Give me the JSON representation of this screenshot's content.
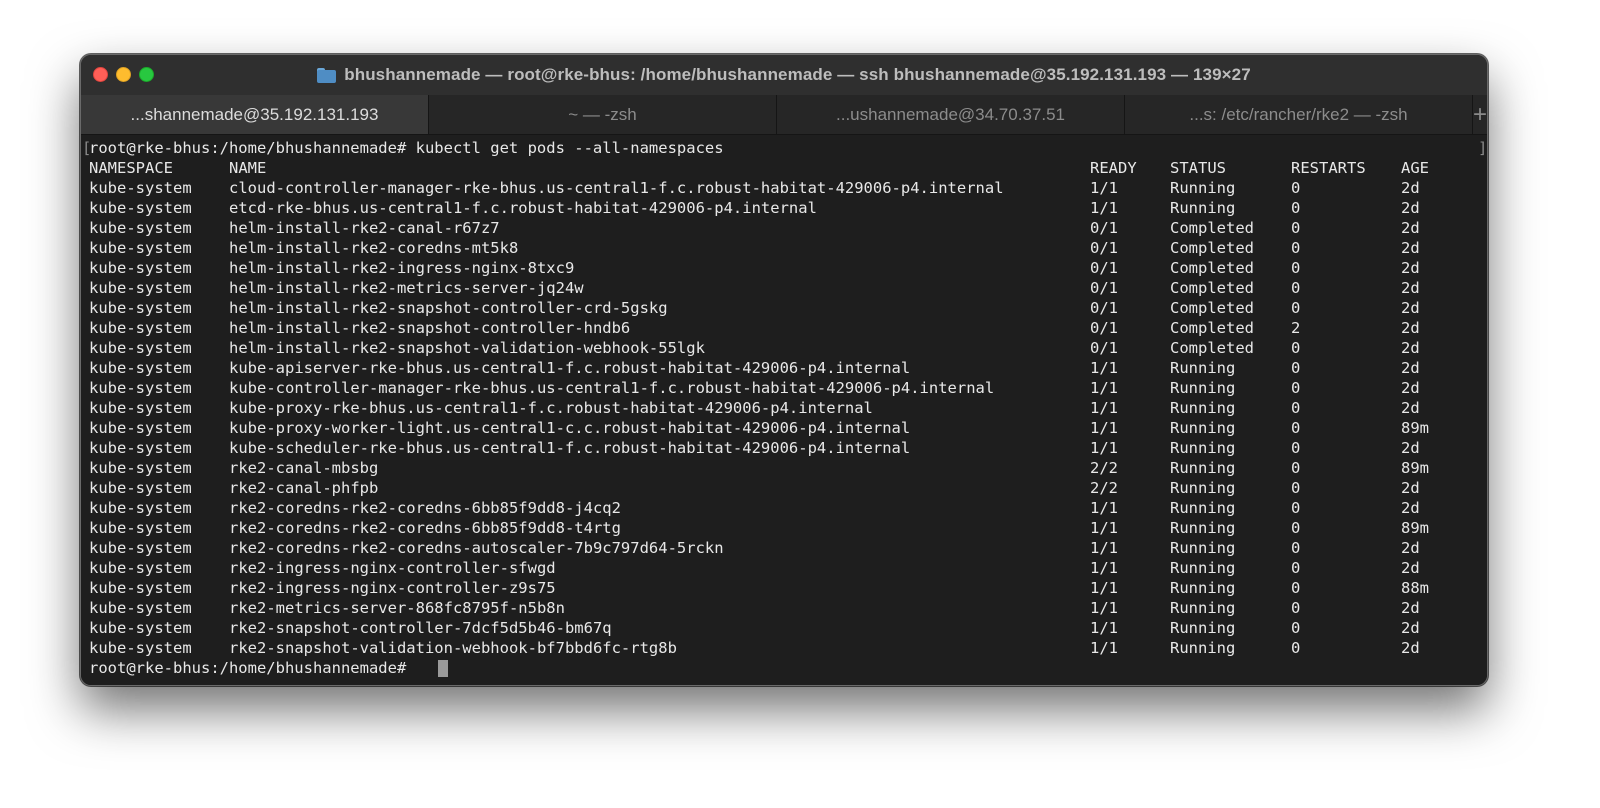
{
  "window": {
    "title": "bhushannemade — root@rke-bhus: /home/bhushannemade — ssh bhushannemade@35.192.131.193 — 139×27",
    "title_icon": "folder-icon"
  },
  "tabs": [
    {
      "label": "...shannemade@35.192.131.193",
      "active": true
    },
    {
      "label": "~ — -zsh",
      "active": false
    },
    {
      "label": "...ushannemade@34.70.37.51",
      "active": false
    },
    {
      "label": "...s: /etc/rancher/rke2 — -zsh",
      "active": false
    }
  ],
  "new_tab_label": "+",
  "terminal": {
    "command_line": "root@rke-bhus:/home/bhushannemade# kubectl get pods --all-namespaces",
    "headers": {
      "namespace": "NAMESPACE",
      "name": "NAME",
      "ready": "READY",
      "status": "STATUS",
      "restarts": "RESTARTS",
      "age": "AGE"
    },
    "rows": [
      {
        "namespace": "kube-system",
        "name": "cloud-controller-manager-rke-bhus.us-central1-f.c.robust-habitat-429006-p4.internal",
        "ready": "1/1",
        "status": "Running",
        "restarts": "0",
        "age": "2d"
      },
      {
        "namespace": "kube-system",
        "name": "etcd-rke-bhus.us-central1-f.c.robust-habitat-429006-p4.internal",
        "ready": "1/1",
        "status": "Running",
        "restarts": "0",
        "age": "2d"
      },
      {
        "namespace": "kube-system",
        "name": "helm-install-rke2-canal-r67z7",
        "ready": "0/1",
        "status": "Completed",
        "restarts": "0",
        "age": "2d"
      },
      {
        "namespace": "kube-system",
        "name": "helm-install-rke2-coredns-mt5k8",
        "ready": "0/1",
        "status": "Completed",
        "restarts": "0",
        "age": "2d"
      },
      {
        "namespace": "kube-system",
        "name": "helm-install-rke2-ingress-nginx-8txc9",
        "ready": "0/1",
        "status": "Completed",
        "restarts": "0",
        "age": "2d"
      },
      {
        "namespace": "kube-system",
        "name": "helm-install-rke2-metrics-server-jq24w",
        "ready": "0/1",
        "status": "Completed",
        "restarts": "0",
        "age": "2d"
      },
      {
        "namespace": "kube-system",
        "name": "helm-install-rke2-snapshot-controller-crd-5gskg",
        "ready": "0/1",
        "status": "Completed",
        "restarts": "0",
        "age": "2d"
      },
      {
        "namespace": "kube-system",
        "name": "helm-install-rke2-snapshot-controller-hndb6",
        "ready": "0/1",
        "status": "Completed",
        "restarts": "2",
        "age": "2d"
      },
      {
        "namespace": "kube-system",
        "name": "helm-install-rke2-snapshot-validation-webhook-55lgk",
        "ready": "0/1",
        "status": "Completed",
        "restarts": "0",
        "age": "2d"
      },
      {
        "namespace": "kube-system",
        "name": "kube-apiserver-rke-bhus.us-central1-f.c.robust-habitat-429006-p4.internal",
        "ready": "1/1",
        "status": "Running",
        "restarts": "0",
        "age": "2d"
      },
      {
        "namespace": "kube-system",
        "name": "kube-controller-manager-rke-bhus.us-central1-f.c.robust-habitat-429006-p4.internal",
        "ready": "1/1",
        "status": "Running",
        "restarts": "0",
        "age": "2d"
      },
      {
        "namespace": "kube-system",
        "name": "kube-proxy-rke-bhus.us-central1-f.c.robust-habitat-429006-p4.internal",
        "ready": "1/1",
        "status": "Running",
        "restarts": "0",
        "age": "2d"
      },
      {
        "namespace": "kube-system",
        "name": "kube-proxy-worker-light.us-central1-c.c.robust-habitat-429006-p4.internal",
        "ready": "1/1",
        "status": "Running",
        "restarts": "0",
        "age": "89m"
      },
      {
        "namespace": "kube-system",
        "name": "kube-scheduler-rke-bhus.us-central1-f.c.robust-habitat-429006-p4.internal",
        "ready": "1/1",
        "status": "Running",
        "restarts": "0",
        "age": "2d"
      },
      {
        "namespace": "kube-system",
        "name": "rke2-canal-mbsbg",
        "ready": "2/2",
        "status": "Running",
        "restarts": "0",
        "age": "89m"
      },
      {
        "namespace": "kube-system",
        "name": "rke2-canal-phfpb",
        "ready": "2/2",
        "status": "Running",
        "restarts": "0",
        "age": "2d"
      },
      {
        "namespace": "kube-system",
        "name": "rke2-coredns-rke2-coredns-6bb85f9dd8-j4cq2",
        "ready": "1/1",
        "status": "Running",
        "restarts": "0",
        "age": "2d"
      },
      {
        "namespace": "kube-system",
        "name": "rke2-coredns-rke2-coredns-6bb85f9dd8-t4rtg",
        "ready": "1/1",
        "status": "Running",
        "restarts": "0",
        "age": "89m"
      },
      {
        "namespace": "kube-system",
        "name": "rke2-coredns-rke2-coredns-autoscaler-7b9c797d64-5rckn",
        "ready": "1/1",
        "status": "Running",
        "restarts": "0",
        "age": "2d"
      },
      {
        "namespace": "kube-system",
        "name": "rke2-ingress-nginx-controller-sfwgd",
        "ready": "1/1",
        "status": "Running",
        "restarts": "0",
        "age": "2d"
      },
      {
        "namespace": "kube-system",
        "name": "rke2-ingress-nginx-controller-z9s75",
        "ready": "1/1",
        "status": "Running",
        "restarts": "0",
        "age": "88m"
      },
      {
        "namespace": "kube-system",
        "name": "rke2-metrics-server-868fc8795f-n5b8n",
        "ready": "1/1",
        "status": "Running",
        "restarts": "0",
        "age": "2d"
      },
      {
        "namespace": "kube-system",
        "name": "rke2-snapshot-controller-7dcf5d5b46-bm67q",
        "ready": "1/1",
        "status": "Running",
        "restarts": "0",
        "age": "2d"
      },
      {
        "namespace": "kube-system",
        "name": "rke2-snapshot-validation-webhook-bf7bbd6fc-rtg8b",
        "ready": "1/1",
        "status": "Running",
        "restarts": "0",
        "age": "2d"
      }
    ],
    "prompt": "root@rke-bhus:/home/bhushannemade#"
  },
  "colors": {
    "background": "#1e1e1e",
    "text": "#e8e8e8",
    "close": "#ff5f57",
    "minimize": "#febc2e",
    "zoom": "#28c840"
  }
}
